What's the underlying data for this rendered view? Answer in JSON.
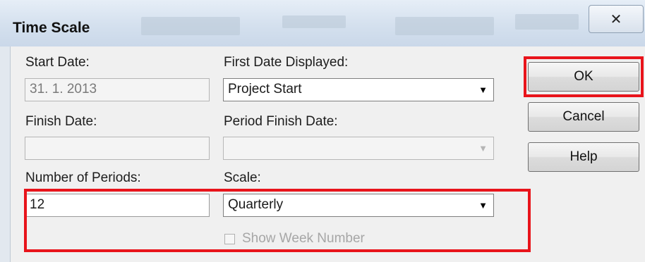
{
  "window": {
    "title": "Time Scale",
    "close_glyph": "✕"
  },
  "form": {
    "start_date_label": "Start Date:",
    "start_date_value": "31. 1. 2013",
    "first_date_label": "First Date Displayed:",
    "first_date_value": "Project Start",
    "finish_date_label": "Finish Date:",
    "finish_date_value": "",
    "period_finish_label": "Period Finish Date:",
    "period_finish_value": "",
    "periods_label": "Number of Periods:",
    "periods_value": "12",
    "scale_label": "Scale:",
    "scale_value": "Quarterly",
    "show_week_label": "Show Week Number",
    "show_week_checked": false
  },
  "buttons": {
    "ok": "OK",
    "cancel": "Cancel",
    "help": "Help"
  },
  "icons": {
    "dropdown": "chevron-down-icon",
    "close": "close-icon"
  },
  "colors": {
    "highlight": "#e8141b",
    "titlebar": "#d4e0ee"
  }
}
